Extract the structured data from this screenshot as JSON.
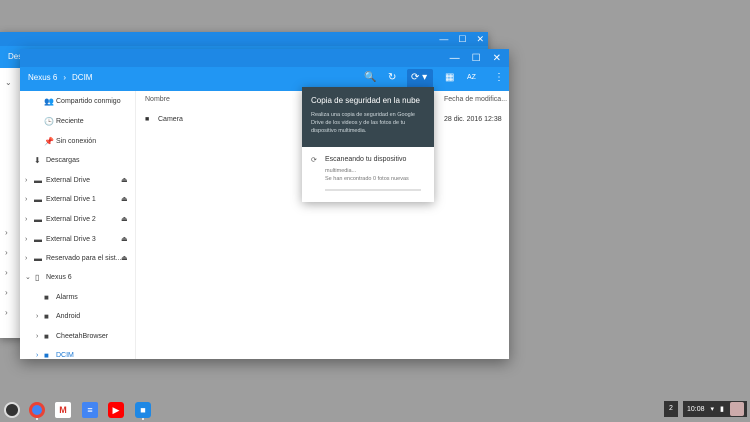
{
  "back_window": {
    "title_partial": "Des",
    "win_controls": [
      "—",
      "☐",
      "✕"
    ]
  },
  "window": {
    "controls": [
      "—",
      "☐",
      "✕"
    ],
    "breadcrumb": [
      "Nexus 6",
      "DCIM"
    ],
    "breadcrumb_sep": "›",
    "toolbar_icons": {
      "search": "🔍",
      "refresh": "↻",
      "sync": "⟳ ▾",
      "grid": "▦",
      "sort": "AZ",
      "more": "⋮"
    }
  },
  "sidebar": {
    "items": [
      {
        "label": "Compartido conmigo",
        "icon": "👥"
      },
      {
        "label": "Reciente",
        "icon": "🕒"
      },
      {
        "label": "Sin conexión",
        "icon": "📌"
      },
      {
        "label": "Descargas",
        "icon": "⬇"
      },
      {
        "label": "External Drive",
        "icon": "▬"
      },
      {
        "label": "External Drive 1",
        "icon": "▬"
      },
      {
        "label": "External Drive 2",
        "icon": "▬"
      },
      {
        "label": "External Drive 3",
        "icon": "▬"
      },
      {
        "label": "Reservado para el sist...",
        "icon": "▬"
      },
      {
        "label": "Nexus 6",
        "icon": "▯"
      },
      {
        "label": "Alarms",
        "icon": "■"
      },
      {
        "label": "Android",
        "icon": "■"
      },
      {
        "label": "CheetahBrowser",
        "icon": "■"
      },
      {
        "label": "DCIM",
        "icon": "■"
      }
    ],
    "arrow_right": "›",
    "arrow_down": "⌄",
    "eject": "⏏"
  },
  "main": {
    "col_name": "Nombre",
    "col_date": "Fecha de modifica...",
    "files": [
      {
        "name": "Camera",
        "date": "28 dic. 2016 12:38",
        "icon": "■"
      }
    ]
  },
  "popup": {
    "title": "Copia de seguridad en la nube",
    "description": "Realiza una copia de seguridad en Google Drive de los videos y de las fotos de tu dispositivo multimedia.",
    "status": "Escaneando tu dispositivo",
    "status_icon": "⟳",
    "sub1": "multimedia...",
    "sub2": "Se han encontrado 0 fotos nuevas"
  },
  "shelf": {
    "badge": "2",
    "time": "10:08",
    "wifi": "▾",
    "battery": "▮"
  }
}
